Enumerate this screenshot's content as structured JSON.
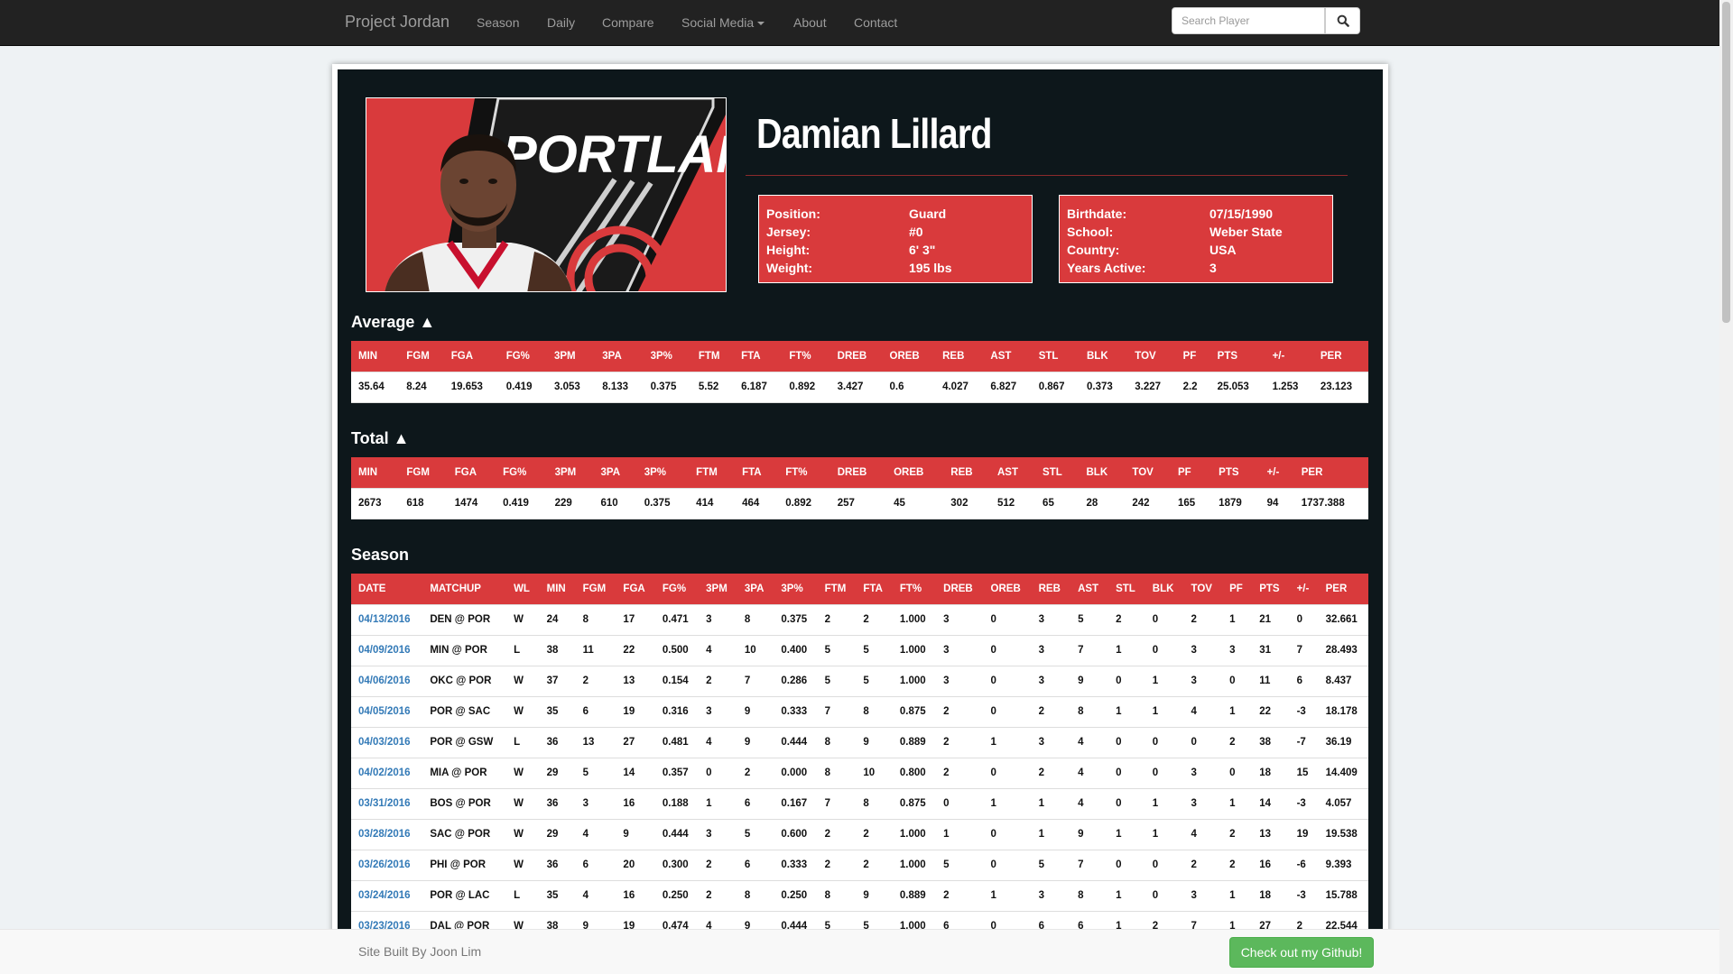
{
  "navbar": {
    "brand": "Project Jordan",
    "items": [
      "Season",
      "Daily",
      "Compare",
      "Social Media",
      "About",
      "Contact"
    ],
    "search_placeholder": "Search Player",
    "search_icon": "search-icon"
  },
  "player": {
    "name": "Damian Lillard",
    "image_text": "PORTLAND",
    "info_left": [
      {
        "label": "Position:",
        "value": "Guard"
      },
      {
        "label": "Jersey:",
        "value": "#0"
      },
      {
        "label": "Height:",
        "value": "6' 3\""
      },
      {
        "label": "Weight:",
        "value": "195 lbs"
      }
    ],
    "info_right": [
      {
        "label": "Birthdate:",
        "value": "07/15/1990"
      },
      {
        "label": "School:",
        "value": "Weber State"
      },
      {
        "label": "Country:",
        "value": "USA"
      },
      {
        "label": "Years Active:",
        "value": "3"
      }
    ]
  },
  "average": {
    "title": "Average ▲",
    "headers": [
      "MIN",
      "FGM",
      "FGA",
      "FG%",
      "3PM",
      "3PA",
      "3P%",
      "FTM",
      "FTA",
      "FT%",
      "DREB",
      "OREB",
      "REB",
      "AST",
      "STL",
      "BLK",
      "TOV",
      "PF",
      "PTS",
      "+/-",
      "PER"
    ],
    "row": [
      "35.64",
      "8.24",
      "19.653",
      "0.419",
      "3.053",
      "8.133",
      "0.375",
      "5.52",
      "6.187",
      "0.892",
      "3.427",
      "0.6",
      "4.027",
      "6.827",
      "0.867",
      "0.373",
      "3.227",
      "2.2",
      "25.053",
      "1.253",
      "23.123"
    ]
  },
  "total": {
    "title": "Total ▲",
    "headers": [
      "MIN",
      "FGM",
      "FGA",
      "FG%",
      "3PM",
      "3PA",
      "3P%",
      "FTM",
      "FTA",
      "FT%",
      "DREB",
      "OREB",
      "REB",
      "AST",
      "STL",
      "BLK",
      "TOV",
      "PF",
      "PTS",
      "+/-",
      "PER"
    ],
    "row": [
      "2673",
      "618",
      "1474",
      "0.419",
      "229",
      "610",
      "0.375",
      "414",
      "464",
      "0.892",
      "257",
      "45",
      "302",
      "512",
      "65",
      "28",
      "242",
      "165",
      "1879",
      "94",
      "1737.388"
    ]
  },
  "season": {
    "title": "Season",
    "headers": [
      "DATE",
      "MATCHUP",
      "WL",
      "MIN",
      "FGM",
      "FGA",
      "FG%",
      "3PM",
      "3PA",
      "3P%",
      "FTM",
      "FTA",
      "FT%",
      "DREB",
      "OREB",
      "REB",
      "AST",
      "STL",
      "BLK",
      "TOV",
      "PF",
      "PTS",
      "+/-",
      "PER"
    ],
    "rows": [
      [
        "04/13/2016",
        "DEN @ POR",
        "W",
        "24",
        "8",
        "17",
        "0.471",
        "3",
        "8",
        "0.375",
        "2",
        "2",
        "1.000",
        "3",
        "0",
        "3",
        "5",
        "2",
        "0",
        "2",
        "1",
        "21",
        "0",
        "32.661"
      ],
      [
        "04/09/2016",
        "MIN @ POR",
        "L",
        "38",
        "11",
        "22",
        "0.500",
        "4",
        "10",
        "0.400",
        "5",
        "5",
        "1.000",
        "3",
        "0",
        "3",
        "7",
        "1",
        "0",
        "3",
        "3",
        "31",
        "7",
        "28.493"
      ],
      [
        "04/06/2016",
        "OKC @ POR",
        "W",
        "37",
        "2",
        "13",
        "0.154",
        "2",
        "7",
        "0.286",
        "5",
        "5",
        "1.000",
        "3",
        "0",
        "3",
        "9",
        "0",
        "1",
        "3",
        "0",
        "11",
        "6",
        "8.437"
      ],
      [
        "04/05/2016",
        "POR @ SAC",
        "W",
        "35",
        "6",
        "19",
        "0.316",
        "3",
        "9",
        "0.333",
        "7",
        "8",
        "0.875",
        "2",
        "0",
        "2",
        "8",
        "1",
        "1",
        "4",
        "1",
        "22",
        "-3",
        "18.178"
      ],
      [
        "04/03/2016",
        "POR @ GSW",
        "L",
        "36",
        "13",
        "27",
        "0.481",
        "4",
        "9",
        "0.444",
        "8",
        "9",
        "0.889",
        "2",
        "1",
        "3",
        "4",
        "0",
        "0",
        "0",
        "2",
        "38",
        "-7",
        "36.19"
      ],
      [
        "04/02/2016",
        "MIA @ POR",
        "W",
        "29",
        "5",
        "14",
        "0.357",
        "0",
        "2",
        "0.000",
        "8",
        "10",
        "0.800",
        "2",
        "0",
        "2",
        "4",
        "0",
        "0",
        "3",
        "0",
        "18",
        "15",
        "14.409"
      ],
      [
        "03/31/2016",
        "BOS @ POR",
        "W",
        "36",
        "3",
        "16",
        "0.188",
        "1",
        "6",
        "0.167",
        "7",
        "8",
        "0.875",
        "0",
        "1",
        "1",
        "4",
        "0",
        "1",
        "3",
        "1",
        "14",
        "-3",
        "4.057"
      ],
      [
        "03/28/2016",
        "SAC @ POR",
        "W",
        "29",
        "4",
        "9",
        "0.444",
        "3",
        "5",
        "0.600",
        "2",
        "2",
        "1.000",
        "1",
        "0",
        "1",
        "9",
        "1",
        "1",
        "4",
        "2",
        "13",
        "19",
        "19.538"
      ],
      [
        "03/26/2016",
        "PHI @ POR",
        "W",
        "36",
        "6",
        "20",
        "0.300",
        "2",
        "6",
        "0.333",
        "2",
        "2",
        "1.000",
        "5",
        "0",
        "5",
        "7",
        "0",
        "0",
        "2",
        "2",
        "16",
        "-6",
        "9.393"
      ],
      [
        "03/24/2016",
        "POR @ LAC",
        "L",
        "35",
        "4",
        "16",
        "0.250",
        "2",
        "8",
        "0.250",
        "8",
        "9",
        "0.889",
        "2",
        "1",
        "3",
        "8",
        "1",
        "0",
        "3",
        "1",
        "18",
        "-3",
        "15.788"
      ],
      [
        "03/23/2016",
        "DAL @ POR",
        "W",
        "38",
        "9",
        "19",
        "0.474",
        "4",
        "9",
        "0.444",
        "5",
        "5",
        "1.000",
        "6",
        "0",
        "6",
        "6",
        "1",
        "2",
        "7",
        "1",
        "27",
        "2",
        "22.544"
      ]
    ]
  },
  "footer": {
    "text": "Site Built By Joon Lim",
    "button": "Check out my Github!"
  },
  "colors": {
    "accent_red": "#d93a3c",
    "panel_dark": "#0d171b",
    "link_blue": "#337ab7",
    "button_green": "#5cb85c"
  }
}
